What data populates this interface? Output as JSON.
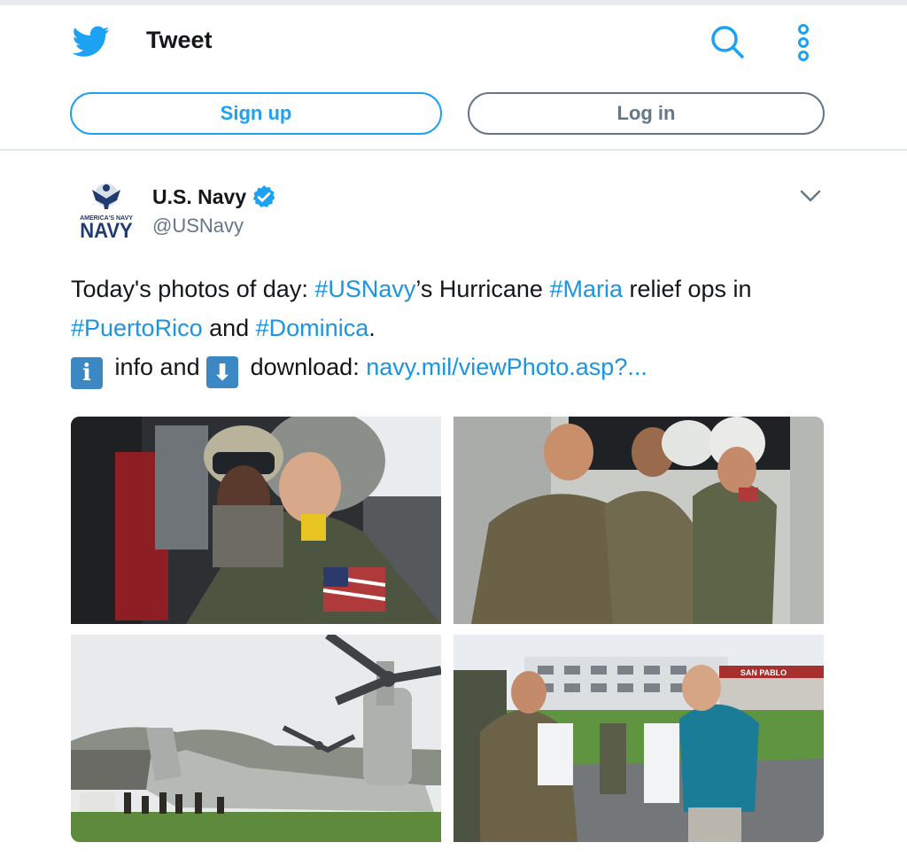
{
  "header": {
    "title": "Tweet",
    "signup_label": "Sign up",
    "login_label": "Log in",
    "icons": [
      "twitter-bird-icon",
      "search-icon",
      "more-options-icon"
    ]
  },
  "tweet": {
    "author": {
      "name": "U.S. Navy",
      "handle": "@USNavy",
      "avatar_text": "AMERICA'S NAVY",
      "verified": true
    },
    "text": {
      "part1": "Today's photos of day: ",
      "hashtag1": "#USNavy",
      "part2": "’s Hurricane ",
      "hashtag2": "#Maria",
      "part3": " relief ops in ",
      "hashtag3": "#PuertoRico",
      "part4": " and ",
      "hashtag4": "#Dominica",
      "part5": ".",
      "info_emoji": "i",
      "part6": " info and ",
      "download_emoji": "⬇",
      "part7": " download: ",
      "link": "navy.mil/viewPhoto.asp?..."
    },
    "photos": [
      {
        "subject": "sailor-holding-child-in-helicopter"
      },
      {
        "subject": "marines-helping-man-from-helicopter"
      },
      {
        "subject": "osprey-aircraft-on-field"
      },
      {
        "subject": "marines-with-doctor-at-hospital",
        "sign_text": "SAN PABLO"
      }
    ]
  },
  "colors": {
    "brand_blue": "#1da1f2",
    "link_blue": "#1b95e0",
    "gray_text": "#657786",
    "divider": "#e1e8ed"
  }
}
